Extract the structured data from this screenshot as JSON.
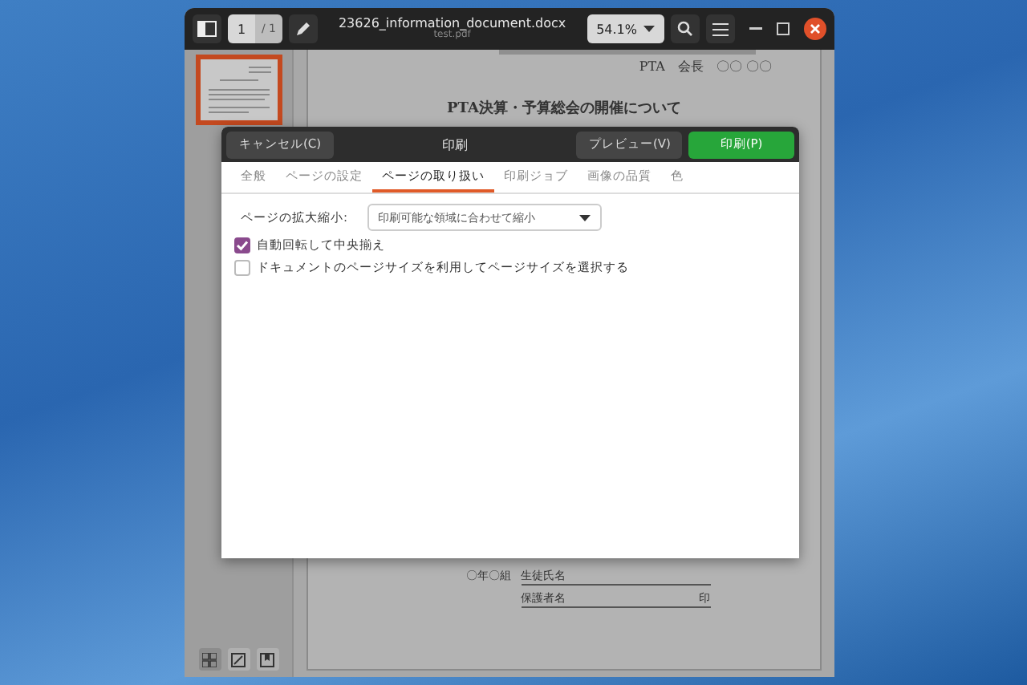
{
  "window": {
    "title": "23626_information_document.docx",
    "subtitle": "test.pdf"
  },
  "toolbar": {
    "page_number": "1",
    "page_total": "/ 1",
    "zoom": "54.1%"
  },
  "document": {
    "header_line": "PTA　会長　〇〇 〇〇",
    "heading": "PTA決算・予算総会の開催について",
    "footer_class": "〇年〇組",
    "footer_fields": [
      {
        "label": "生徒氏名"
      },
      {
        "label": "保護者名",
        "stamp": "印"
      }
    ]
  },
  "dialog": {
    "title": "印刷",
    "cancel": "キャンセル(C)",
    "preview": "プレビュー(V)",
    "print": "印刷(P)",
    "tabs": [
      {
        "label": "全般",
        "selected": false
      },
      {
        "label": "ページの設定",
        "selected": false
      },
      {
        "label": "ページの取り扱い",
        "selected": true
      },
      {
        "label": "印刷ジョブ",
        "selected": false
      },
      {
        "label": "画像の品質",
        "selected": false
      },
      {
        "label": "色",
        "selected": false
      }
    ],
    "scale_label": "ページの拡大縮小:",
    "scale_value": "印刷可能な領域に合わせて縮小",
    "options": [
      {
        "label": "自動回転して中央揃え",
        "checked": true
      },
      {
        "label": "ドキュメントのページサイズを利用してページサイズを選択する",
        "checked": false
      }
    ]
  }
}
